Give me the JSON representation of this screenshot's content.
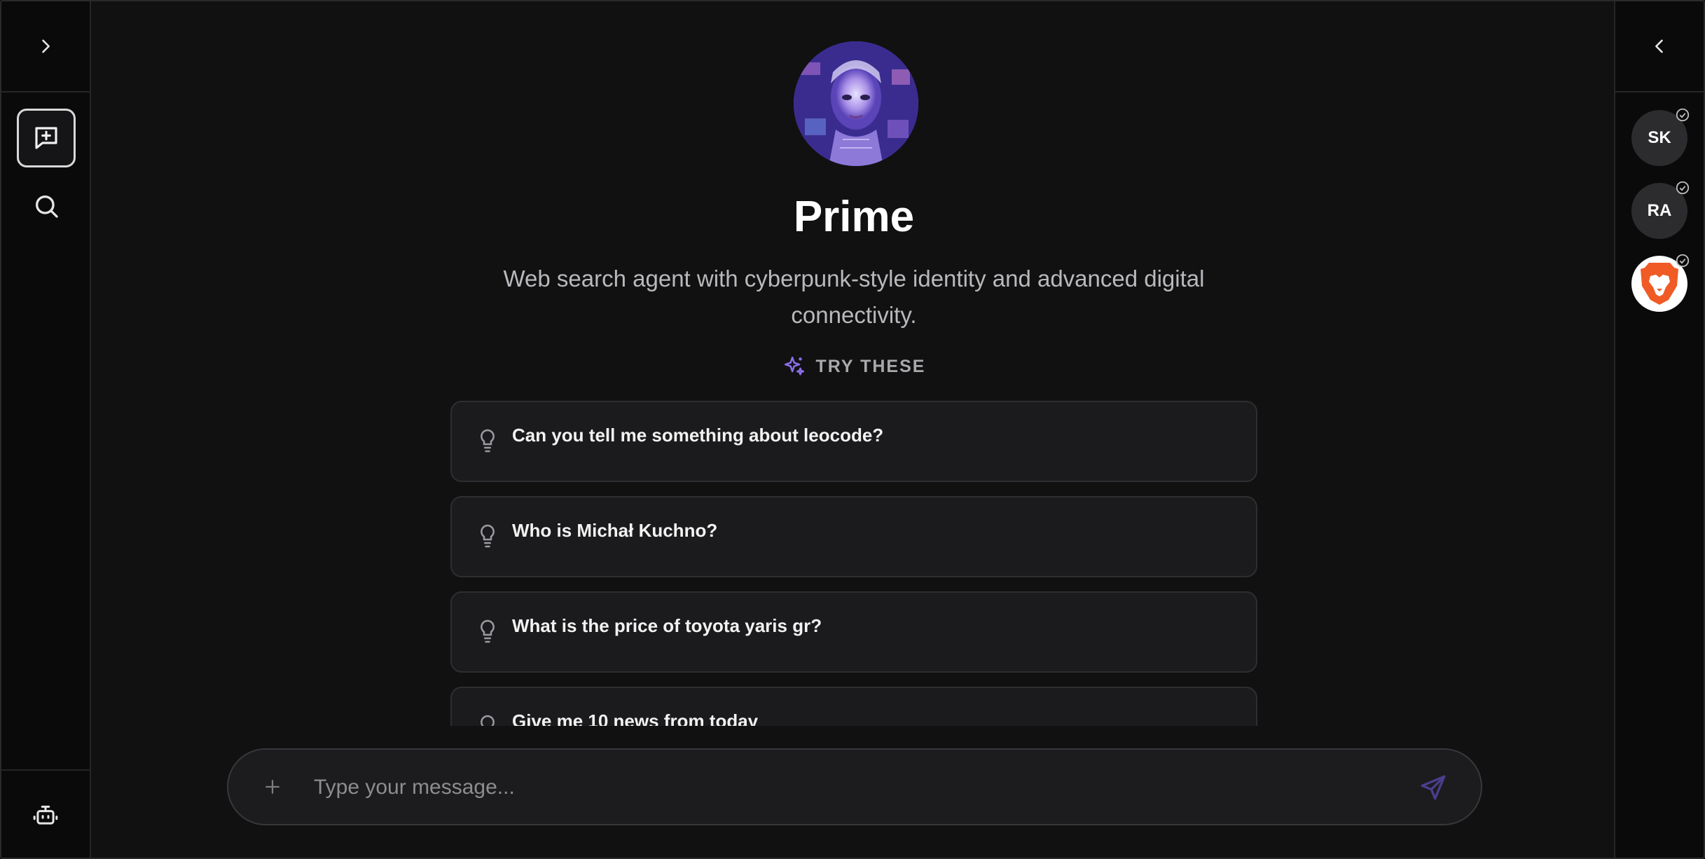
{
  "agent": {
    "name": "Prime",
    "description": "Web search agent with cyberpunk-style identity and advanced digital connectivity."
  },
  "try_these": {
    "label": "TRY THESE",
    "suggestions": [
      "Can you tell me something about leocode?",
      "Who is Michał Kuchno?",
      "What is the price of toyota yaris gr?",
      "Give me 10 news from today"
    ]
  },
  "composer": {
    "placeholder": "Type your message..."
  },
  "right_sidebar": {
    "agents": [
      {
        "initials": "SK"
      },
      {
        "initials": "RA"
      },
      {
        "initials": ""
      }
    ]
  },
  "colors": {
    "accent": "#7b5cd6",
    "brave_orange": "#f05a24"
  },
  "icons": {
    "left_toggle": "chevron-right-icon",
    "right_toggle": "chevron-left-icon",
    "new_chat": "message-plus-icon",
    "search": "search-icon",
    "agents": "bot-icon",
    "try_these": "sparkles-icon",
    "suggestion": "lightbulb-icon",
    "attach": "plus-icon",
    "send": "send-icon"
  }
}
